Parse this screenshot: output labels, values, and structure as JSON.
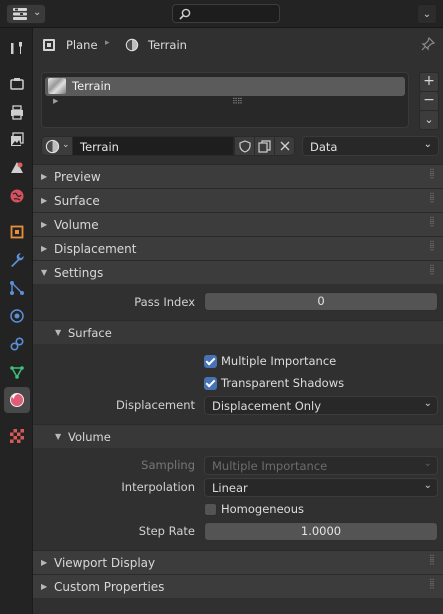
{
  "header": {
    "editor_type_icon": "properties-editor-icon",
    "search_icon": "search-icon",
    "collapse_icon": "chevron-down-icon"
  },
  "tabs": [
    {
      "name": "tool-tab",
      "icon": "wrench-screwdriver-icon"
    },
    {
      "name": "render-tab",
      "icon": "camera-back-icon"
    },
    {
      "name": "output-tab",
      "icon": "printer-icon"
    },
    {
      "name": "view-layer-tab",
      "icon": "image-stack-icon"
    },
    {
      "name": "scene-tab",
      "icon": "scene-cone-icon"
    },
    {
      "name": "world-tab",
      "icon": "world-globe-icon"
    },
    {
      "name": "object-tab",
      "icon": "object-square-icon"
    },
    {
      "name": "modifiers-tab",
      "icon": "wrench-icon"
    },
    {
      "name": "particles-tab",
      "icon": "particles-icon"
    },
    {
      "name": "physics-tab",
      "icon": "physics-orbit-icon"
    },
    {
      "name": "constraints-tab",
      "icon": "constraint-icon"
    },
    {
      "name": "data-tab",
      "icon": "mesh-data-icon"
    },
    {
      "name": "material-tab",
      "icon": "material-sphere-icon",
      "active": true
    },
    {
      "name": "texture-tab",
      "icon": "checker-texture-icon"
    }
  ],
  "breadcrumb": {
    "object": "Plane",
    "material": "Terrain"
  },
  "material_slots": {
    "items": [
      "Terrain"
    ],
    "add_label": "+",
    "remove_label": "−",
    "specials_label": "⌄"
  },
  "material_selector": {
    "name": "Terrain",
    "link_mode": "Data"
  },
  "panels": {
    "preview": "Preview",
    "surface": "Surface",
    "volume": "Volume",
    "displacement": "Displacement",
    "settings": "Settings",
    "viewport_display": "Viewport Display",
    "custom_properties": "Custom Properties"
  },
  "settings": {
    "pass_index_label": "Pass Index",
    "pass_index_value": "0",
    "surface_sub": "Surface",
    "multiple_importance_label": "Multiple Importance",
    "multiple_importance_checked": true,
    "transparent_shadows_label": "Transparent Shadows",
    "transparent_shadows_checked": true,
    "displacement_label": "Displacement",
    "displacement_value": "Displacement Only",
    "volume_sub": "Volume",
    "sampling_label": "Sampling",
    "sampling_value": "Multiple Importance",
    "interpolation_label": "Interpolation",
    "interpolation_value": "Linear",
    "homogeneous_label": "Homogeneous",
    "homogeneous_checked": false,
    "step_rate_label": "Step Rate",
    "step_rate_value": "1.0000"
  }
}
